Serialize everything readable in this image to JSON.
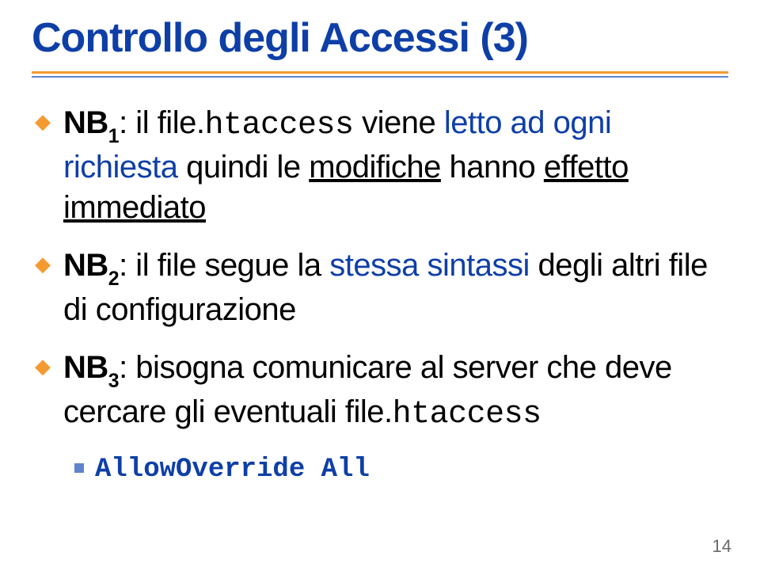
{
  "title": "Controllo degli Accessi (3)",
  "items": [
    {
      "nb_prefix": "NB",
      "nb_sub": "1",
      "before_mono": ": il file.",
      "mono": "htaccess",
      "after_mono_normal1": " viene ",
      "after_mono_blue": "letto ad ogni richiesta",
      "after_mono_normal2": " quindi le ",
      "underlined1": "modifiche",
      "mid_normal": " hanno ",
      "underlined2": "effetto immediato"
    },
    {
      "nb_prefix": "NB",
      "nb_sub": "2",
      "before": ": il file segue la ",
      "blue": "stessa sintassi",
      "after": " degli altri file di configurazione"
    },
    {
      "nb_prefix": "NB",
      "nb_sub": "3",
      "text_before_mono": ": bisogna comunicare al server che deve cercare gli eventuali file.",
      "mono": "htaccess"
    }
  ],
  "sub_item": "AllowOverride All",
  "page_number": "14"
}
